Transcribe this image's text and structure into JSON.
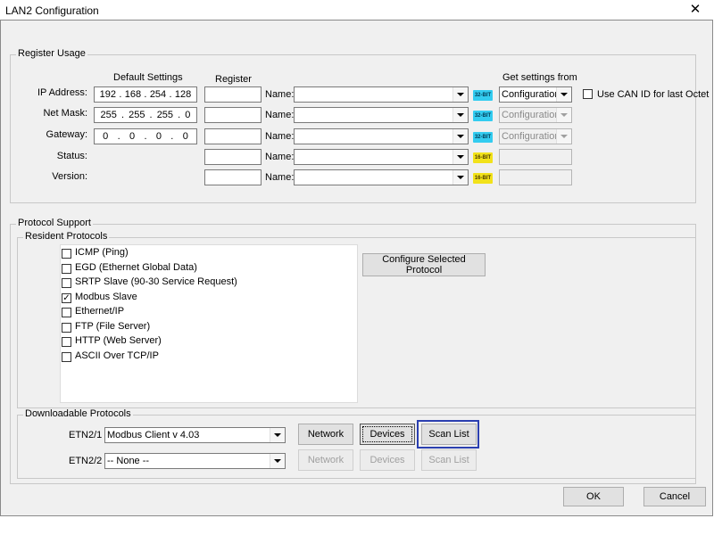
{
  "window": {
    "title": "LAN2 Configuration",
    "close_glyph": "✕"
  },
  "register_usage": {
    "legend": "Register Usage",
    "headers": {
      "default_settings": "Default Settings",
      "register": "Register",
      "get_settings_from": "Get settings from"
    },
    "name_label": "Name:",
    "rows": [
      {
        "label": "IP Address:",
        "ip": [
          "192",
          "168",
          "254",
          "128"
        ],
        "register": "",
        "name": "",
        "bits": "32-BIT",
        "get_from": "Configuration",
        "get_from_enabled": true
      },
      {
        "label": "Net Mask:",
        "ip": [
          "255",
          "255",
          "255",
          "0"
        ],
        "register": "",
        "name": "",
        "bits": "32-BIT",
        "get_from": "Configuration",
        "get_from_enabled": false
      },
      {
        "label": "Gateway:",
        "ip": [
          "0",
          "0",
          "0",
          "0"
        ],
        "register": "",
        "name": "",
        "bits": "32-BIT",
        "get_from": "Configuration",
        "get_from_enabled": false
      },
      {
        "label": "Status:",
        "register": "",
        "name": "",
        "bits": "16-BIT",
        "get_from": ""
      },
      {
        "label": "Version:",
        "register": "",
        "name": "",
        "bits": "16-BIT",
        "get_from": ""
      }
    ],
    "use_can_id": {
      "label": "Use CAN ID for last Octet",
      "checked": false
    }
  },
  "protocol_support": {
    "legend": "Protocol Support",
    "resident": {
      "legend": "Resident Protocols",
      "items": [
        {
          "label": "ICMP (Ping)",
          "checked": false
        },
        {
          "label": "EGD (Ethernet Global Data)",
          "checked": false
        },
        {
          "label": "SRTP Slave (90-30 Service Request)",
          "checked": false
        },
        {
          "label": "Modbus Slave",
          "checked": true
        },
        {
          "label": "Ethernet/IP",
          "checked": false
        },
        {
          "label": "FTP (File Server)",
          "checked": false
        },
        {
          "label": "HTTP (Web Server)",
          "checked": false
        },
        {
          "label": "ASCII Over TCP/IP",
          "checked": false
        }
      ],
      "configure_button": "Configure Selected Protocol"
    },
    "downloadable": {
      "legend": "Downloadable Protocols",
      "rows": [
        {
          "label": "ETN2/1",
          "value": "Modbus Client  v 4.03",
          "network": "Network",
          "devices": "Devices",
          "scan_list": "Scan List",
          "enabled": true
        },
        {
          "label": "ETN2/2",
          "value": "-- None --",
          "network": "Network",
          "devices": "Devices",
          "scan_list": "Scan List",
          "enabled": false
        }
      ]
    }
  },
  "footer": {
    "ok": "OK",
    "cancel": "Cancel"
  },
  "check_glyph": "✓",
  "colors": {
    "badge_32": "#33ccf0",
    "badge_16": "#f2e21a",
    "highlight": "#2b3fb0"
  }
}
